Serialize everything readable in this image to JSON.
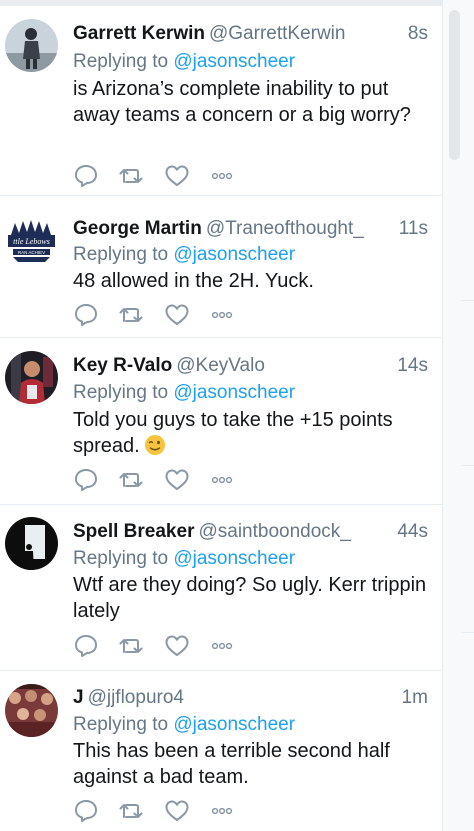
{
  "tweets": [
    {
      "name": "Garrett Kerwin",
      "handle": "@GarrettKerwin",
      "time": "8s",
      "replying_prefix": "Replying to",
      "replying_to": "@jasonscheer",
      "text": "is Arizona’s complete inability to put away teams a concern or a big worry?",
      "avatar_icon": "person-silhouette-avatar"
    },
    {
      "name": "George Martin",
      "handle": "@Traneofthought_",
      "time": "11s",
      "replying_prefix": "Replying to",
      "replying_to": "@jasonscheer",
      "text": "48 allowed in the 2H. Yuck.",
      "avatar_icon": "big-lebowski-logo-avatar"
    },
    {
      "name": "Key R-Valo",
      "handle": "@KeyValo",
      "time": "14s",
      "replying_prefix": "Replying to",
      "replying_to": "@jasonscheer",
      "text": "Told you guys to take the +15 points spread.",
      "emoji": "winking-face",
      "avatar_icon": "player-photo-avatar"
    },
    {
      "name": "Spell Breaker",
      "handle": "@saintboondock_",
      "time": "44s",
      "replying_prefix": "Replying to",
      "replying_to": "@jasonscheer",
      "text": "Wtf are they doing? So ugly. Kerr trippin lately",
      "avatar_icon": "doorway-silhouette-avatar"
    },
    {
      "name": "J",
      "handle": "@jjflopuro4",
      "time": "1m",
      "replying_prefix": "Replying to",
      "replying_to": "@jasonscheer",
      "text": "This has been a terrible second half against a bad team.",
      "avatar_icon": "crowd-photo-avatar"
    }
  ],
  "colors": {
    "text": "#14171a",
    "secondary": "#657786",
    "link": "#1da1f2",
    "divider": "#e6ecf0"
  }
}
